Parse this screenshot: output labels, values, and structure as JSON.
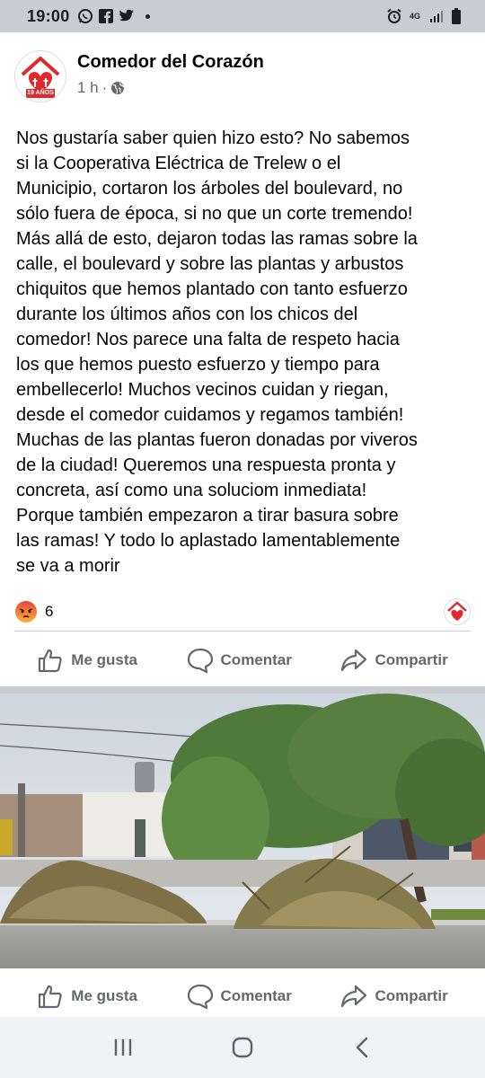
{
  "status_bar": {
    "time": "19:00",
    "network": "4G"
  },
  "post": {
    "page_name": "Comedor del Corazón",
    "time_ago": "1 h",
    "dot": "·",
    "avatar_badge": "19 AÑOS",
    "text": "Nos gustaría saber quien hizo esto? No sabemos\nsi la Cooperativa Eléctrica  de Trelew o el\nMunicipio, cortaron los árboles del boulevard, no\nsólo fuera de época, si no que un corte tremendo!\nMás allá de esto, dejaron todas las ramas sobre la\ncalle, el boulevard y sobre las plantas y arbustos\nchiquitos que hemos plantado con tanto esfuerzo\ndurante los últimos años con los chicos del\ncomedor! Nos parece una falta de respeto hacia\nlos que hemos puesto esfuerzo y tiempo para\nembellecerlo! Muchos vecinos cuidan y riegan,\ndesde el comedor cuidamos y regamos también!\nMuchas de las plantas fueron donadas por viveros\nde la ciudad! Queremos una respuesta pronta y\nconcreta, así como una soluciom inmediata!\nPorque también empezaron a tirar basura sobre\nlas ramas! Y todo lo aplastado lamentablemente\nse va a morir",
    "reaction_count": "6",
    "actions": {
      "like": "Me gusta",
      "comment": "Comentar",
      "share": "Compartir"
    }
  },
  "photo_actions": {
    "like": "Me gusta",
    "comment": "Comentar",
    "share": "Compartir"
  },
  "colors": {
    "brand_red": "#e0282d",
    "angry_orange": "#f36d3a",
    "meta_gray": "#65676b",
    "status_bg": "#c9ccd1"
  },
  "icons": [
    "whatsapp-icon",
    "facebook-icon",
    "twitter-icon",
    "alarm-icon",
    "signal-icon",
    "battery-icon",
    "globe-icon",
    "angry-reaction-icon",
    "like-icon",
    "comment-icon",
    "share-icon",
    "recents-icon",
    "home-icon",
    "back-icon"
  ]
}
